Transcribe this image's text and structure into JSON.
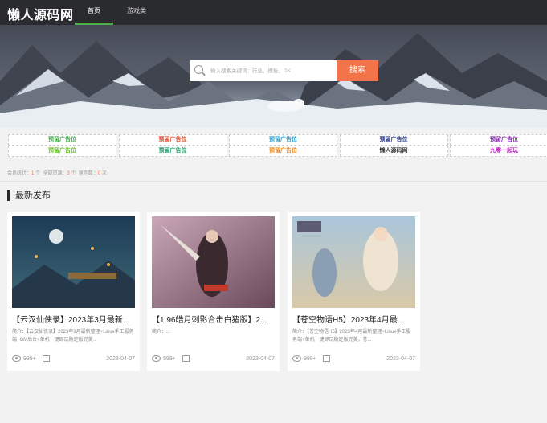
{
  "header": {
    "logo": "懒人源码网",
    "nav": [
      "首页",
      "游戏类"
    ],
    "accent": "#4caf50"
  },
  "search": {
    "placeholder": "输入搜索关键词：行业、模板、DK",
    "button": "搜索",
    "button_color": "#f4744a"
  },
  "ads": [
    [
      {
        "label": "预留广告位",
        "color": "#4caf50"
      },
      {
        "label": "预留广告位",
        "color": "#e0502e"
      },
      {
        "label": "预留广告位",
        "color": "#35a7d6"
      },
      {
        "label": "预留广告位",
        "color": "#2b3a8c"
      },
      {
        "label": "预留广告位",
        "color": "#8b2fb0"
      }
    ],
    [
      {
        "label": "预留广告位",
        "color": "#6cbf2c"
      },
      {
        "label": "预留广告位",
        "color": "#22a06b"
      },
      {
        "label": "预留广告位",
        "color": "#f08a1a"
      },
      {
        "label": "懒人源码网",
        "color": "#333333"
      },
      {
        "label": "九零一起玩",
        "color": "#c025c8"
      }
    ]
  ],
  "stats": {
    "members_label": "会员统计：",
    "members": "1",
    "all_label": "全部资源：",
    "all": "3",
    "today_label": "留言数：",
    "today": "0",
    "unit": "个",
    "unit2": "次"
  },
  "section": {
    "title": "最新发布"
  },
  "cards": [
    {
      "title": "【云汉仙侠录】2023年3月最新...",
      "desc": "简介：【云汉仙侠录】2023年3月最新整理+Linux手工服务端+GM后台+单机一键即玩稳定版完美...",
      "views": "999+",
      "date": "2023-04-07"
    },
    {
      "title": "【1.96皓月刺影合击白猪版】2...",
      "desc": "简介：...",
      "views": "999+",
      "date": "2023-04-07"
    },
    {
      "title": "【苍空物语H5】2023年4月最...",
      "desc": "简介：【苍空物语H5】2023年4月最新整理+Linux手工服务端+单机一键即玩稳定版完美，苍...",
      "views": "999+",
      "date": "2023-04-07"
    }
  ]
}
